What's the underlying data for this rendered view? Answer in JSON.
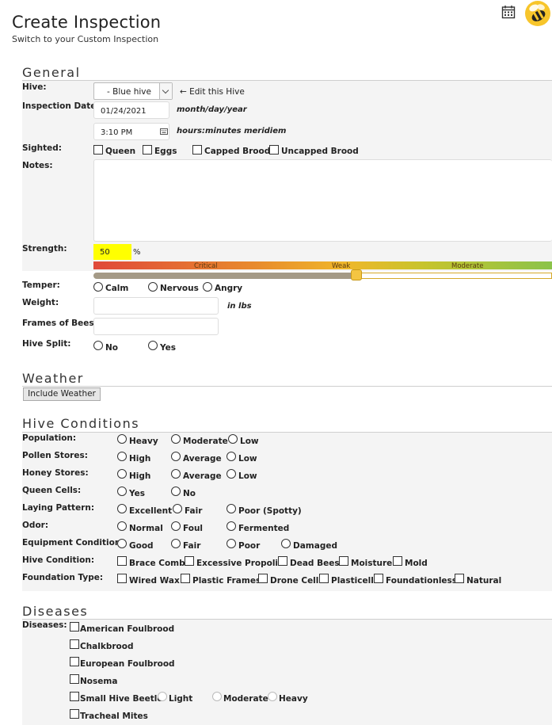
{
  "header": {
    "title": "Create Inspection",
    "subtitle": "Switch to your Custom Inspection"
  },
  "icons": {
    "calendar": "calendar-icon",
    "avatar": "bee-avatar-icon"
  },
  "general": {
    "title": "General",
    "hive": {
      "label": "Hive:",
      "value": "- Blue hive",
      "edit_link": "← Edit this Hive"
    },
    "inspection_date": {
      "label": "Inspection Date:",
      "date": "01/24/2021",
      "date_hint": "month/day/year",
      "time": "3:10 PM",
      "time_hint": "hours:minutes meridiem"
    },
    "sighted": {
      "label": "Sighted:",
      "options": [
        "Queen",
        "Eggs",
        "Capped Brood",
        "Uncapped Brood"
      ]
    },
    "notes": {
      "label": "Notes:",
      "value": ""
    },
    "strength": {
      "label": "Strength:",
      "value": "50",
      "unit": "%",
      "scale": [
        "Critical",
        "Weak",
        "Moderate"
      ],
      "level_percent": 50
    },
    "temper": {
      "label": "Temper:",
      "options": [
        "Calm",
        "Nervous",
        "Angry"
      ]
    },
    "weight": {
      "label": "Weight:",
      "value": "",
      "unit": "in lbs"
    },
    "frames": {
      "label": "Frames of Bees:",
      "value": ""
    },
    "hive_split": {
      "label": "Hive Split:",
      "options": [
        "No",
        "Yes"
      ]
    }
  },
  "weather": {
    "title": "Weather",
    "button": "Include Weather"
  },
  "conditions": {
    "title": "Hive Conditions",
    "population": {
      "label": "Population:",
      "options": [
        "Heavy",
        "Moderate",
        "Low"
      ]
    },
    "pollen": {
      "label": "Pollen Stores:",
      "options": [
        "High",
        "Average",
        "Low"
      ]
    },
    "honey": {
      "label": "Honey Stores:",
      "options": [
        "High",
        "Average",
        "Low"
      ]
    },
    "queen_cells": {
      "label": "Queen Cells:",
      "options": [
        "Yes",
        "No"
      ]
    },
    "laying": {
      "label": "Laying Pattern:",
      "options": [
        "Excellent",
        "Fair",
        "Poor (Spotty)"
      ]
    },
    "odor": {
      "label": "Odor:",
      "options": [
        "Normal",
        "Foul",
        "Fermented"
      ]
    },
    "equipment": {
      "label": "Equipment Condition:",
      "options": [
        "Good",
        "Fair",
        "Poor",
        "Damaged"
      ]
    },
    "hive_condition": {
      "label": "Hive Condition:",
      "options": [
        "Brace Comb",
        "Excessive Propolis",
        "Dead Bees",
        "Moisture",
        "Mold"
      ]
    },
    "foundation": {
      "label": "Foundation Type:",
      "options": [
        "Wired Wax",
        "Plastic Frames",
        "Drone Cell",
        "Plasticell",
        "Foundationless",
        "Natural"
      ]
    }
  },
  "diseases": {
    "title": "Diseases",
    "label": "Diseases:",
    "items": [
      "American Foulbrood",
      "Chalkbrood",
      "European Foulbrood",
      "Nosema",
      "Small Hive Beetle",
      "Tracheal Mites"
    ],
    "shb_levels": [
      "Light",
      "Moderate",
      "Heavy"
    ]
  },
  "colors": {
    "strength_highlight": "#ffff00",
    "slider_handle": "#f4c542"
  }
}
